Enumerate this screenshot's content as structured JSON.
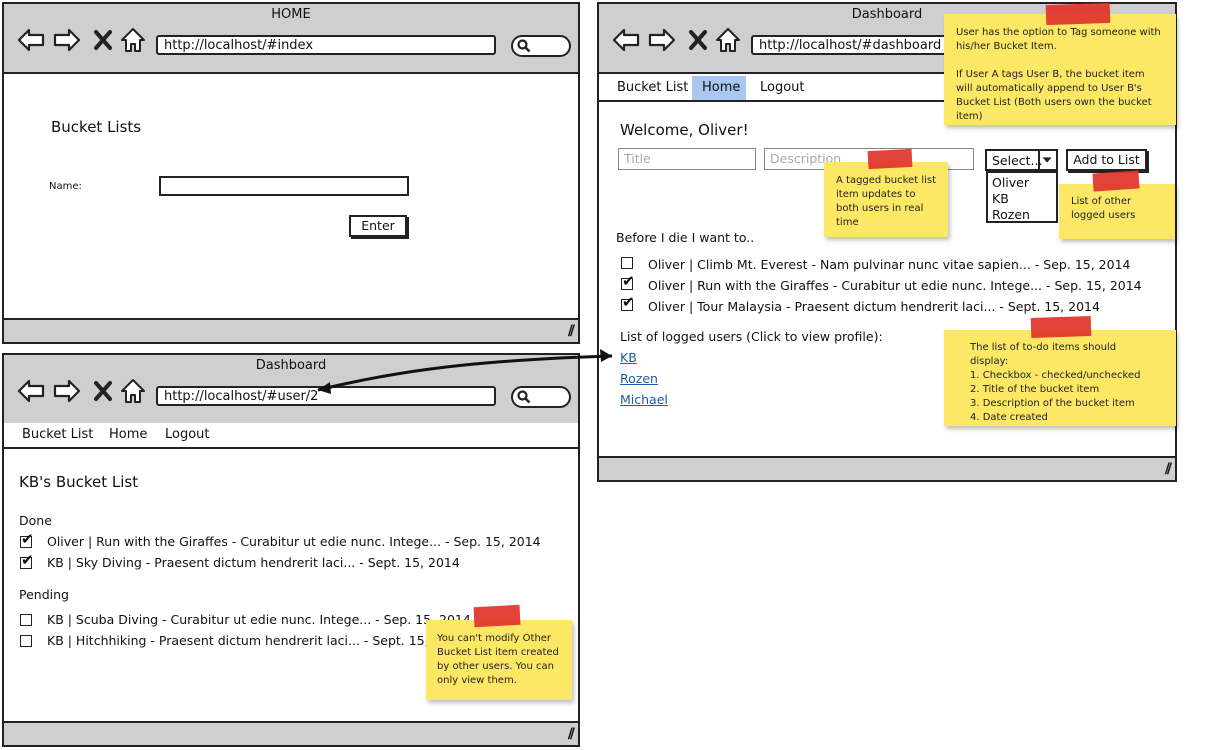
{
  "windows": {
    "home": {
      "title": "HOME",
      "url": "http://localhost/#index",
      "heading": "Bucket Lists",
      "name_label": "Name:",
      "name_value": "",
      "enter_label": "Enter"
    },
    "user": {
      "title": "Dashboard",
      "url": "http://localhost/#user/2",
      "menu": [
        "Bucket List",
        "Home",
        "Logout"
      ],
      "heading": "KB's Bucket List",
      "done_label": "Done",
      "done_items": [
        "Oliver | Run with the Giraffes - Curabitur ut edie nunc. Intege... - Sep. 15, 2014",
        "KB | Sky Diving - Praesent dictum hendrerit laci... - Sept. 15, 2014"
      ],
      "pending_label": "Pending",
      "pending_items": [
        "KB | Scuba Diving - Curabitur ut edie nunc. Intege... - Sep. 15, 2014",
        "KB | Hitchhiking - Praesent dictum hendrerit laci... - Sept. 15, 2014"
      ]
    },
    "dashboard": {
      "title": "Dashboard",
      "url": "http://localhost/#dashboard",
      "menu": [
        "Bucket List",
        "Home",
        "Logout"
      ],
      "active_menu": "Home",
      "welcome": "Welcome, Oliver!",
      "title_placeholder": "Title",
      "description_placeholder": "Description",
      "select_label": "Select...",
      "select_options": [
        "Oliver",
        "KB",
        "Rozen"
      ],
      "add_button": "Add to List",
      "list_intro": "Before I die I want to..",
      "items": [
        {
          "text": "Oliver | Climb Mt. Everest - Nam pulvinar nunc vitae sapien... - Sep. 15, 2014",
          "checked": false
        },
        {
          "text": "Oliver | Run with the Giraffes - Curabitur ut edie nunc. Intege... - Sep. 15, 2014",
          "checked": true
        },
        {
          "text": "Oliver | Tour Malaysia - Praesent dictum hendrerit laci... - Sept. 15, 2014",
          "checked": true
        }
      ],
      "logged_users_label": "List of logged users (Click to view profile):",
      "logged_users": [
        "KB",
        "Rozen",
        "Michael"
      ]
    }
  },
  "notes": {
    "tag": [
      "User has the option to Tag someone with his/her Bucket Item.",
      "If User A tags User B, the bucket item will automatically append to User B's Bucket List (Both users own the bucket item)"
    ],
    "realtime": "A tagged bucket list item updates to both users in real time",
    "logged": "List of other logged users",
    "display": [
      "The list of to-do items should display:",
      "1. Checkbox - checked/unchecked",
      "2. Title of the bucket item",
      "3. Description of the bucket item",
      "4. Date created"
    ],
    "readonly": "You can't modify Other Bucket List item created by other users. You can only view them."
  },
  "colors": {
    "chrome": "#cfcfcf",
    "active_tab": "#a9c7f0",
    "sticky": "#fde865",
    "tape": "#e0332a",
    "link": "#1d5aa8"
  }
}
